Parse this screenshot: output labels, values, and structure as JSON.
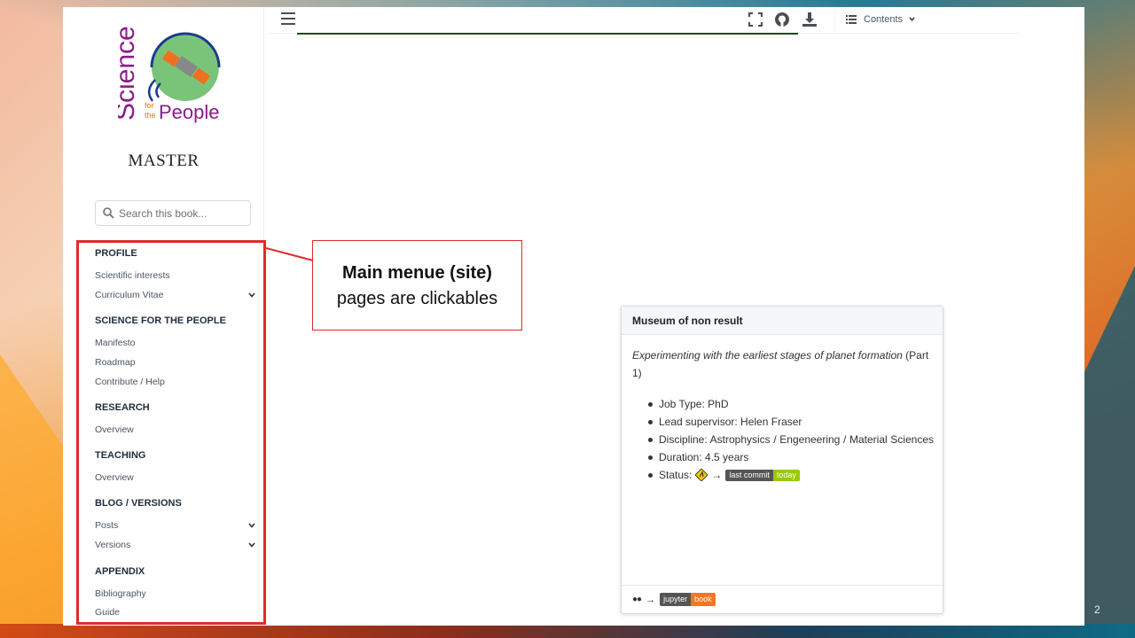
{
  "sidebar": {
    "logo_text": {
      "word1": "Science",
      "word2": "for",
      "word3": "the",
      "word4": "People"
    },
    "site_title": "MASTER",
    "search_placeholder": "Search this book...",
    "sections": [
      {
        "title": "PROFILE",
        "items": [
          {
            "label": "Scientific interests",
            "expandable": false
          },
          {
            "label": "Curriculum Vitae",
            "expandable": true
          }
        ]
      },
      {
        "title": "SCIENCE FOR THE PEOPLE",
        "items": [
          {
            "label": "Manifesto",
            "expandable": false
          },
          {
            "label": "Roadmap",
            "expandable": false
          },
          {
            "label": "Contribute / Help",
            "expandable": false
          }
        ]
      },
      {
        "title": "RESEARCH",
        "items": [
          {
            "label": "Overview",
            "expandable": false
          }
        ]
      },
      {
        "title": "TEACHING",
        "items": [
          {
            "label": "Overview",
            "expandable": false
          }
        ]
      },
      {
        "title": "BLOG / VERSIONS",
        "items": [
          {
            "label": "Posts",
            "expandable": true
          },
          {
            "label": "Versions",
            "expandable": true
          }
        ]
      },
      {
        "title": "APPENDIX",
        "items": [
          {
            "label": "Bibliography",
            "expandable": false
          },
          {
            "label": "Guide",
            "expandable": false
          }
        ]
      }
    ]
  },
  "header": {
    "toc_label": "Contents",
    "icons": [
      "menu-icon",
      "fullscreen-icon",
      "github-icon",
      "download-icon",
      "list-icon"
    ]
  },
  "callout": {
    "line1": "Main menue (site)",
    "line2": "pages are clickables"
  },
  "card": {
    "title": "Museum of non result",
    "intro_italic": "Experimenting with the earliest stages of planet formation",
    "intro_suffix": " (Part 1)",
    "items": [
      "Job Type: PhD",
      "Lead supervisor: Helen Fraser",
      "Discipline: Astrophysics / Engeneering / Material Sciences",
      "Duration: 4.5 years"
    ],
    "status_label": "Status:",
    "arrow": "→",
    "badge_left": "last commit",
    "badge_right": "today",
    "footer_badge_left": "jupyter",
    "footer_badge_right": "book"
  },
  "slide": {
    "page_number": "2"
  },
  "colors": {
    "accent_red": "#e02b2b",
    "badge_green": "#97ca00",
    "jb_orange": "#f37726",
    "logo_purple": "#8b1a8b"
  }
}
